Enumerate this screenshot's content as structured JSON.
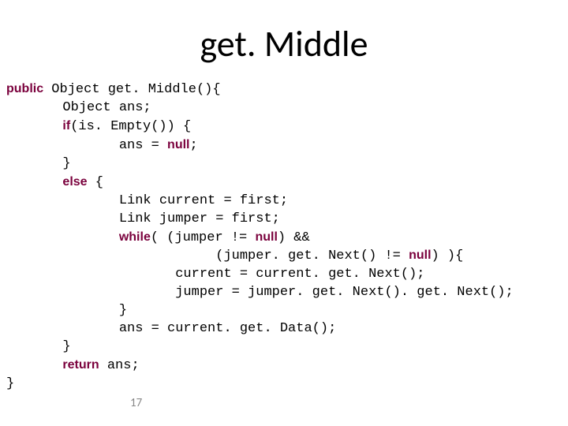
{
  "title": "get. Middle",
  "page_number": "17",
  "code_lines": [
    {
      "segments": [
        {
          "kw": true,
          "t": "public"
        },
        {
          "kw": false,
          "t": " Object get. Middle(){"
        }
      ]
    },
    {
      "segments": [
        {
          "kw": false,
          "t": "       Object ans;"
        }
      ]
    },
    {
      "segments": [
        {
          "kw": false,
          "t": "       "
        },
        {
          "kw": true,
          "t": "if"
        },
        {
          "kw": false,
          "t": "(is. Empty()) {"
        }
      ]
    },
    {
      "segments": [
        {
          "kw": false,
          "t": "              ans = "
        },
        {
          "kw": true,
          "t": "null"
        },
        {
          "kw": false,
          "t": ";"
        }
      ]
    },
    {
      "segments": [
        {
          "kw": false,
          "t": "       }"
        }
      ]
    },
    {
      "segments": [
        {
          "kw": false,
          "t": "       "
        },
        {
          "kw": true,
          "t": "else"
        },
        {
          "kw": false,
          "t": " {"
        }
      ]
    },
    {
      "segments": [
        {
          "kw": false,
          "t": "              Link current = first;"
        }
      ]
    },
    {
      "segments": [
        {
          "kw": false,
          "t": "              Link jumper = first;"
        }
      ]
    },
    {
      "segments": [
        {
          "kw": false,
          "t": "              "
        },
        {
          "kw": true,
          "t": "while"
        },
        {
          "kw": false,
          "t": "( (jumper != "
        },
        {
          "kw": true,
          "t": "null"
        },
        {
          "kw": false,
          "t": ") && "
        }
      ]
    },
    {
      "segments": [
        {
          "kw": false,
          "t": "                          (jumper. get. Next() != "
        },
        {
          "kw": true,
          "t": "null"
        },
        {
          "kw": false,
          "t": ") ){"
        }
      ]
    },
    {
      "segments": [
        {
          "kw": false,
          "t": "                     current = current. get. Next();"
        }
      ]
    },
    {
      "segments": [
        {
          "kw": false,
          "t": "                     jumper = jumper. get. Next(). get. Next();"
        }
      ]
    },
    {
      "segments": [
        {
          "kw": false,
          "t": "              }"
        }
      ]
    },
    {
      "segments": [
        {
          "kw": false,
          "t": "              ans = current. get. Data();"
        }
      ]
    },
    {
      "segments": [
        {
          "kw": false,
          "t": "       }"
        }
      ]
    },
    {
      "segments": [
        {
          "kw": false,
          "t": "       "
        },
        {
          "kw": true,
          "t": "return"
        },
        {
          "kw": false,
          "t": " ans;"
        }
      ]
    },
    {
      "segments": [
        {
          "kw": false,
          "t": "}"
        }
      ]
    }
  ]
}
